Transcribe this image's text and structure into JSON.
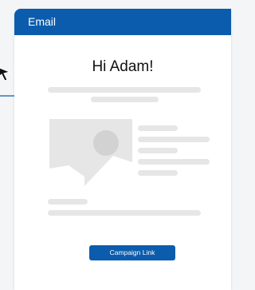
{
  "email": {
    "header_title": "Email",
    "greeting": "Hi Adam!"
  },
  "link_badge": {
    "label": "Campaign Link"
  },
  "colors": {
    "accent": "#0b5cad",
    "placeholder": "#e6e6e6",
    "background": "#f4f5f7"
  },
  "icons": [
    "cursor-arrow-icon",
    "image-placeholder-icon"
  ]
}
